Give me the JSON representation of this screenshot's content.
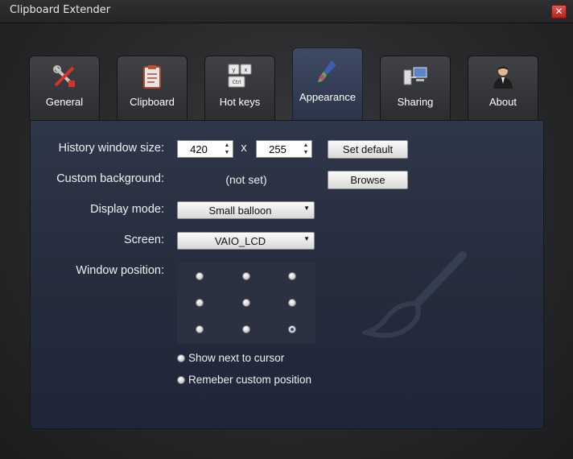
{
  "window": {
    "title": "Clipboard Extender",
    "close_glyph": "✕"
  },
  "tabs": [
    {
      "label": "General",
      "icon": "tools-icon",
      "active": false
    },
    {
      "label": "Clipboard",
      "icon": "clipboard-icon",
      "active": false
    },
    {
      "label": "Hot keys",
      "icon": "keyboard-keys-icon",
      "active": false
    },
    {
      "label": "Appearance",
      "icon": "paint-brush-icon",
      "active": true
    },
    {
      "label": "Sharing",
      "icon": "network-computers-icon",
      "active": false
    },
    {
      "label": "About",
      "icon": "person-icon",
      "active": false
    }
  ],
  "keys_icon": {
    "k1": "y",
    "k2": "x",
    "k3": "Ctrl"
  },
  "appearance": {
    "history_size_label": "History window size:",
    "width": "420",
    "separator": "x",
    "height": "255",
    "set_default": "Set default",
    "custom_bg_label": "Custom background:",
    "custom_bg_value": "(not set)",
    "browse": "Browse",
    "display_mode_label": "Display mode:",
    "display_mode_value": "Small balloon",
    "screen_label": "Screen:",
    "screen_value": "VAIO_LCD",
    "window_position_label": "Window position:",
    "position_selected": {
      "row": 3,
      "col": 3
    },
    "show_next_to_cursor": "Show next to cursor",
    "remember_custom": "Remeber custom position"
  }
}
